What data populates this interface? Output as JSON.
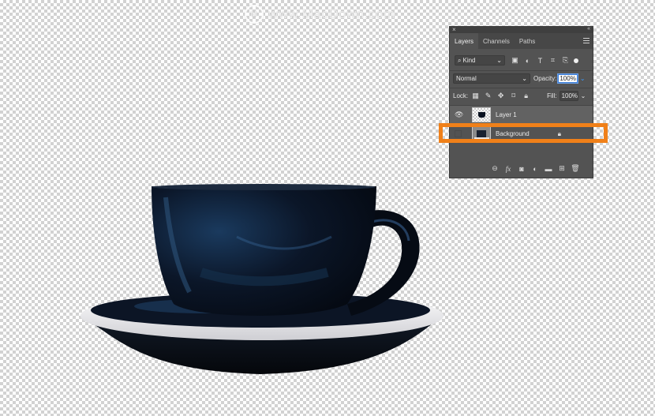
{
  "watermark": {
    "logo_letter": "M",
    "text": "www.MacDown.com"
  },
  "panel": {
    "tabs": [
      {
        "label": "Layers",
        "active": true
      },
      {
        "label": "Channels",
        "active": false
      },
      {
        "label": "Paths",
        "active": false
      }
    ],
    "filter": {
      "icon": "search-icon",
      "value": "Kind",
      "filter_icons": [
        "image-filter-icon",
        "adjustment-filter-icon",
        "type-filter-icon",
        "shape-filter-icon",
        "smart-object-filter-icon"
      ]
    },
    "blend_mode": "Normal",
    "opacity_label": "Opacity:",
    "opacity_value": "100%",
    "lock_label": "Lock:",
    "fill_label": "Fill:",
    "fill_value": "100%",
    "layers": [
      {
        "name": "Layer 1",
        "visible": true,
        "locked": false
      },
      {
        "name": "Background",
        "visible": false,
        "locked": true
      }
    ],
    "bottom_icons": [
      "link-icon",
      "fx-icon",
      "mask-icon",
      "adjustment-layer-icon",
      "group-folder-icon",
      "new-layer-icon",
      "trash-icon"
    ],
    "fx_label": "fx"
  },
  "colors": {
    "highlight": "#f08019",
    "panel_bg": "#535353",
    "selected_row": "#626262"
  }
}
